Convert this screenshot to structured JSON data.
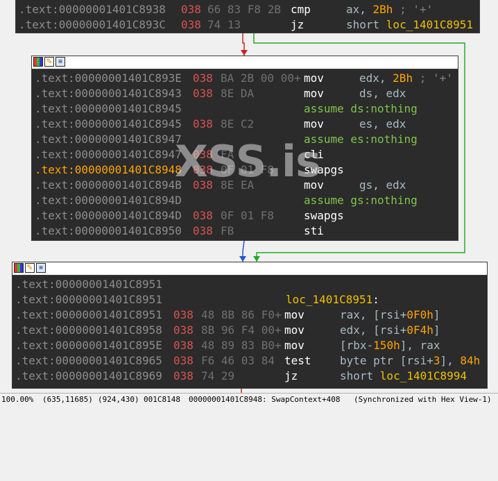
{
  "watermark": "XSS.is",
  "colors": {
    "graph_bg": "#f0f0f0",
    "node_bg": "#2b2b2b",
    "address": "#8d8d8d",
    "active_address": "#ffa400",
    "stack": "#d9534f",
    "bytes": "#707070",
    "mnemonic": "#ffffff",
    "directive": "#7fc44b",
    "operand": "#aabbc4",
    "number": "#ffa400",
    "label": "#f0c000",
    "edge_red": "#cc2222",
    "edge_green": "#22aa22",
    "edge_blue": "#2255cc"
  },
  "icons": [
    "graph-overview-icon",
    "edit-icon",
    "code-view-icon"
  ],
  "block_top": {
    "lines": [
      {
        "addr": ".text:00000001401C8938",
        "stack": "038",
        "bytes": "66 83 F8 2B",
        "mnem": "cmp",
        "ops": "ax, ",
        "num": "2Bh",
        "cmt": " ; '+'",
        "lbl": ""
      },
      {
        "addr": ".text:00000001401C893C",
        "stack": "038",
        "bytes": "74 13",
        "mnem": "jz",
        "ops": "short ",
        "num": "",
        "cmt": "",
        "lbl": "loc_1401C8951"
      }
    ]
  },
  "block_middle": {
    "lines": [
      {
        "addr": ".text:00000001401C893E",
        "stack": "038",
        "bytes": "BA 2B 00 00+",
        "mnem": "mov",
        "ops": "edx, ",
        "num": "2Bh",
        "cmt": " ; '+'",
        "dir": ""
      },
      {
        "addr": ".text:00000001401C8943",
        "stack": "038",
        "bytes": "8E DA",
        "mnem": "mov",
        "ops": "ds, edx",
        "num": "",
        "cmt": "",
        "dir": ""
      },
      {
        "addr": ".text:00000001401C8945",
        "stack": "",
        "bytes": "",
        "mnem": "",
        "ops": "",
        "num": "",
        "cmt": "",
        "dir": "assume ds:nothing"
      },
      {
        "addr": ".text:00000001401C8945",
        "stack": "038",
        "bytes": "8E C2",
        "mnem": "mov",
        "ops": "es, edx",
        "num": "",
        "cmt": "",
        "dir": ""
      },
      {
        "addr": ".text:00000001401C8947",
        "stack": "",
        "bytes": "",
        "mnem": "",
        "ops": "",
        "num": "",
        "cmt": "",
        "dir": "assume es:nothing"
      },
      {
        "addr": ".text:00000001401C8947",
        "stack": "038",
        "bytes": "FA",
        "mnem": "cli",
        "ops": "",
        "num": "",
        "cmt": "",
        "dir": ""
      },
      {
        "addr": ".text:00000001401C8948",
        "stack": "038",
        "bytes": "0F 01 F8",
        "mnem": "swapgs",
        "ops": "",
        "num": "",
        "cmt": "",
        "dir": "",
        "active": true
      },
      {
        "addr": ".text:00000001401C894B",
        "stack": "038",
        "bytes": "8E EA",
        "mnem": "mov",
        "ops": "gs, edx",
        "num": "",
        "cmt": "",
        "dir": ""
      },
      {
        "addr": ".text:00000001401C894D",
        "stack": "",
        "bytes": "",
        "mnem": "",
        "ops": "",
        "num": "",
        "cmt": "",
        "dir": "assume gs:nothing"
      },
      {
        "addr": ".text:00000001401C894D",
        "stack": "038",
        "bytes": "0F 01 F8",
        "mnem": "swapgs",
        "ops": "",
        "num": "",
        "cmt": "",
        "dir": ""
      },
      {
        "addr": ".text:00000001401C8950",
        "stack": "038",
        "bytes": "FB",
        "mnem": "sti",
        "ops": "",
        "num": "",
        "cmt": "",
        "dir": ""
      }
    ]
  },
  "block_bottom": {
    "lines": [
      {
        "addr": ".text:00000001401C8951",
        "stack": "",
        "bytes": "",
        "mnem": "",
        "ops": "",
        "opsTail": "",
        "lbl": "",
        "lblTail": ""
      },
      {
        "addr": ".text:00000001401C8951",
        "stack": "",
        "bytes": "",
        "mnem": "",
        "ops": "",
        "opsTail": "",
        "lbl": "loc_1401C8951",
        "lblTail": ":"
      },
      {
        "addr": ".text:00000001401C8951",
        "stack": "038",
        "bytes": "48 8B 86 F0+",
        "mnem": "mov",
        "ops": "rax, [rsi+",
        "num": "0F0h",
        "opsTail": "]",
        "lbl": "",
        "lblTail": ""
      },
      {
        "addr": ".text:00000001401C8958",
        "stack": "038",
        "bytes": "8B 96 F4 00+",
        "mnem": "mov",
        "ops": "edx, [rsi+",
        "num": "0F4h",
        "opsTail": "]",
        "lbl": "",
        "lblTail": ""
      },
      {
        "addr": ".text:00000001401C895E",
        "stack": "038",
        "bytes": "48 89 83 B0+",
        "mnem": "mov",
        "ops": "[rbx-",
        "num": "150h",
        "opsTail": "], rax",
        "lbl": "",
        "lblTail": ""
      },
      {
        "addr": ".text:00000001401C8965",
        "stack": "038",
        "bytes": "F6 46 03 84",
        "mnem": "test",
        "ops": "byte ptr [rsi+",
        "num": "3",
        "opsTail": "], ",
        "num2": "84h",
        "lbl": "",
        "lblTail": ""
      },
      {
        "addr": ".text:00000001401C8969",
        "stack": "038",
        "bytes": "74 29",
        "mnem": "jz",
        "ops": "short ",
        "num": "",
        "opsTail": "",
        "lbl": "loc_1401C8994",
        "lblTail": ""
      }
    ]
  },
  "statusbar": {
    "zoom": "100.00%",
    "coords1": "(635,11685)",
    "coords2": "(924,430)",
    "offset": "001C8148",
    "location": "00000001401C8948: SwapContext+408",
    "sync": "(Synchronized with Hex View-1)"
  }
}
